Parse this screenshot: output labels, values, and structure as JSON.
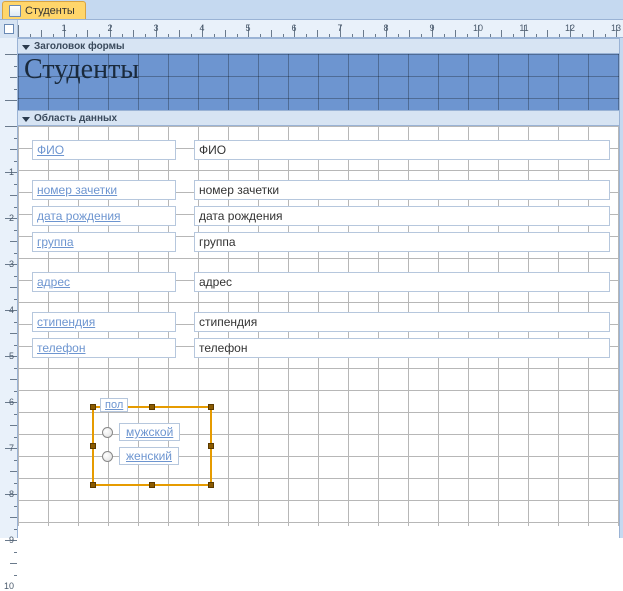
{
  "tab": {
    "title": "Студенты"
  },
  "sections": {
    "formHeader": "Заголовок формы",
    "detail": "Область данных"
  },
  "formTitle": "Студенты",
  "fields": [
    {
      "label": "ФИО",
      "bound": "ФИО"
    },
    {
      "label": "номер зачетки",
      "bound": "номер зачетки"
    },
    {
      "label": "дата рождения",
      "bound": "дата рождения"
    },
    {
      "label": "группа",
      "bound": "группа"
    },
    {
      "label": "адрес",
      "bound": "адрес"
    },
    {
      "label": "стипендия",
      "bound": "стипендия"
    },
    {
      "label": "телефон",
      "bound": "телефон"
    }
  ],
  "optionGroup": {
    "legend": "пол",
    "options": [
      "мужской",
      "женский"
    ]
  },
  "ruler": {
    "unitPx": 46,
    "hMajors": [
      1,
      2,
      3,
      4,
      5,
      6,
      7,
      8,
      9,
      10,
      11,
      12,
      13
    ],
    "vMajors": [
      1,
      2,
      3,
      4,
      5,
      6,
      7,
      8,
      9,
      10
    ]
  },
  "rowTops": [
    14,
    54,
    80,
    106,
    146,
    186,
    212
  ]
}
